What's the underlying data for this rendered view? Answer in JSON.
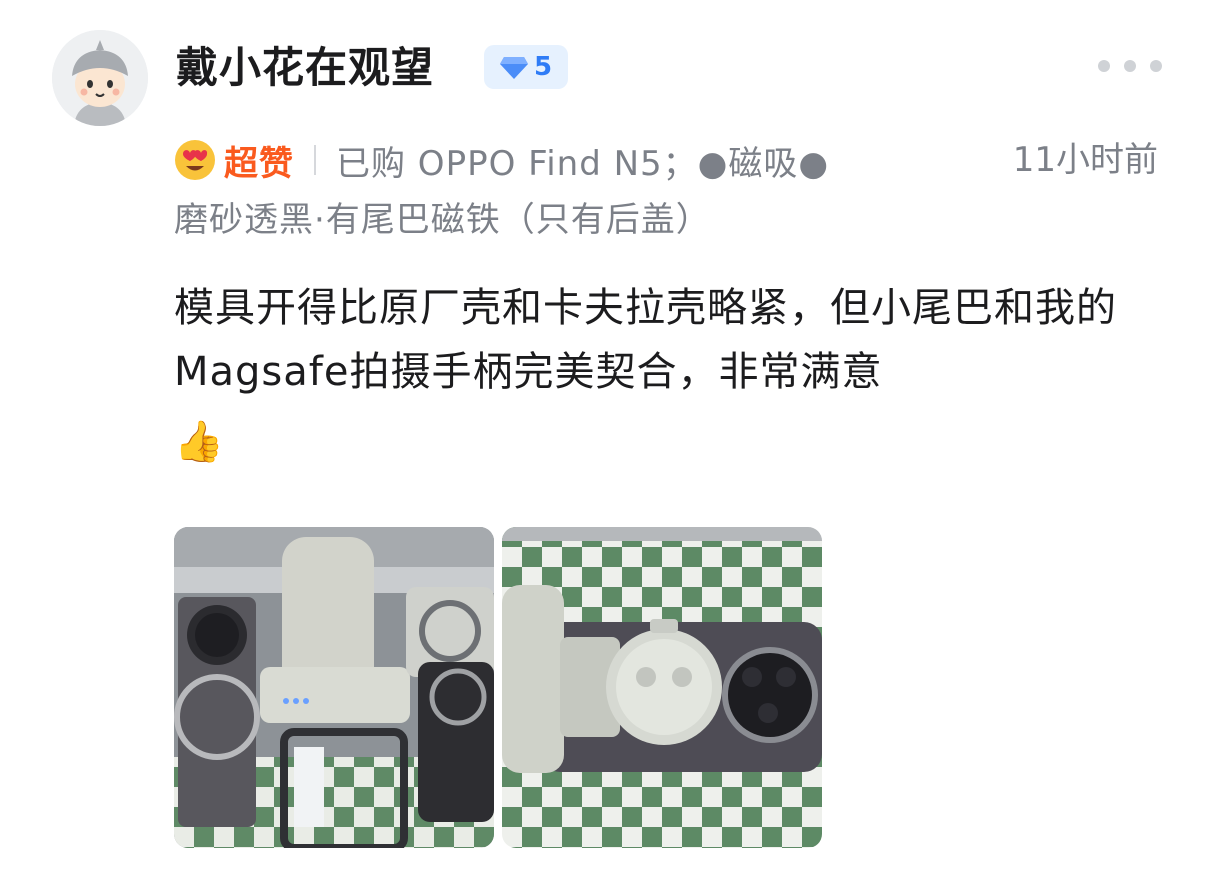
{
  "user": {
    "name": "戴小花在观望",
    "level": "5"
  },
  "review": {
    "rating_label": "超赞",
    "purchase_line1": "已购 OPPO Find N5；●磁吸●",
    "purchase_line2": "磨砂透黑·有尾巴磁铁（只有后盖）",
    "time": "11小时前",
    "content": "模具开得比原厂壳和卡夫拉壳略紧，但小尾巴和我的Magsafe拍摄手柄完美契合，非常满意",
    "thumbs": "👍"
  },
  "colors": {
    "accent_blue": "#2f7cf6",
    "rating_orange": "#fa5a1e",
    "meta_gray": "#7c8088"
  },
  "icons": [
    "avatar-cartoon",
    "diamond-level-icon",
    "more-dots-icon",
    "heart-eyes-emoji"
  ]
}
